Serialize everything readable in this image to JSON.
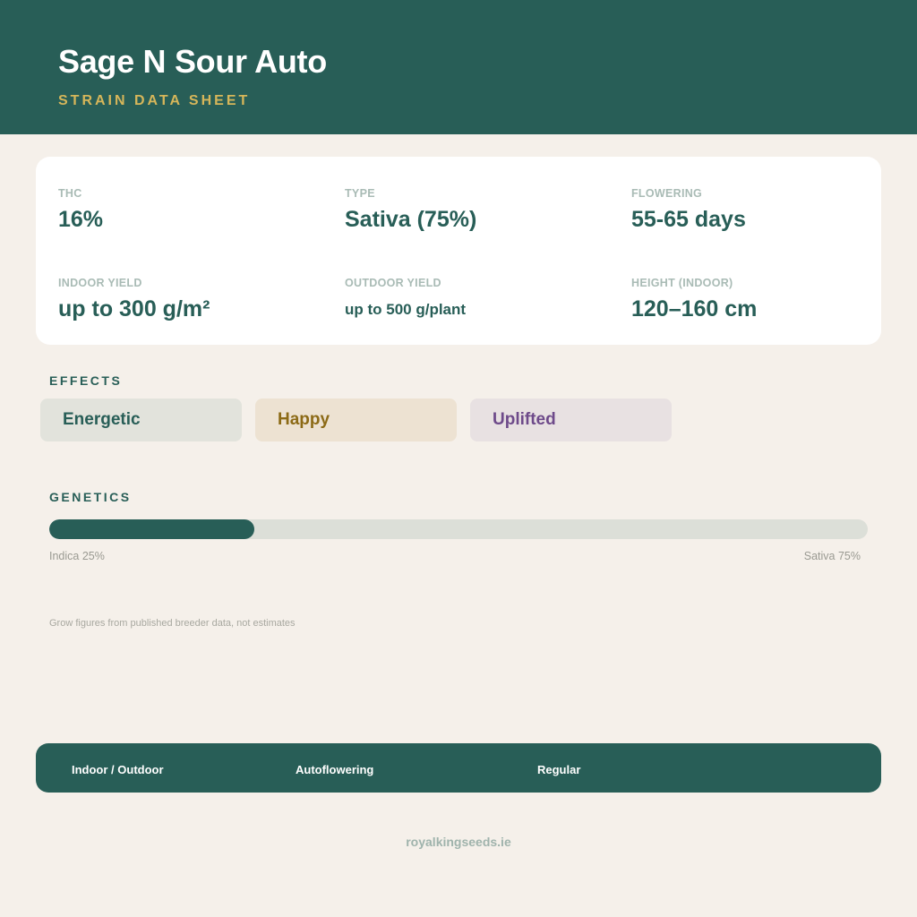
{
  "header": {
    "title": "Sage N Sour Auto",
    "subtitle": "STRAIN DATA SHEET"
  },
  "stats": [
    {
      "label": "THC",
      "value": "16%"
    },
    {
      "label": "TYPE",
      "value": "Sativa (75%)"
    },
    {
      "label": "FLOWERING",
      "value": "55-65 days"
    },
    {
      "label": "INDOOR YIELD",
      "value": "up to 300 g/m²"
    },
    {
      "label": "OUTDOOR YIELD",
      "value": "up to 500 g/plant"
    },
    {
      "label": "HEIGHT (INDOOR)",
      "value": "120–160 cm"
    }
  ],
  "effects": {
    "label": "EFFECTS",
    "items": [
      "Energetic",
      "Happy",
      "Uplifted"
    ]
  },
  "genetics": {
    "label": "GENETICS",
    "indica_caption": "Indica 25%",
    "sativa_caption": "Sativa 75%",
    "indica_fraction": 0.25
  },
  "note": "Grow figures from published breeder data, not estimates",
  "footer": {
    "items": [
      "Indoor / Outdoor",
      "Autoflowering",
      "Regular"
    ]
  },
  "site": "royalkingseeds.ie",
  "colors": {
    "primary": "#285e57",
    "accent": "#d6b65a",
    "background": "#f5f0ea"
  }
}
